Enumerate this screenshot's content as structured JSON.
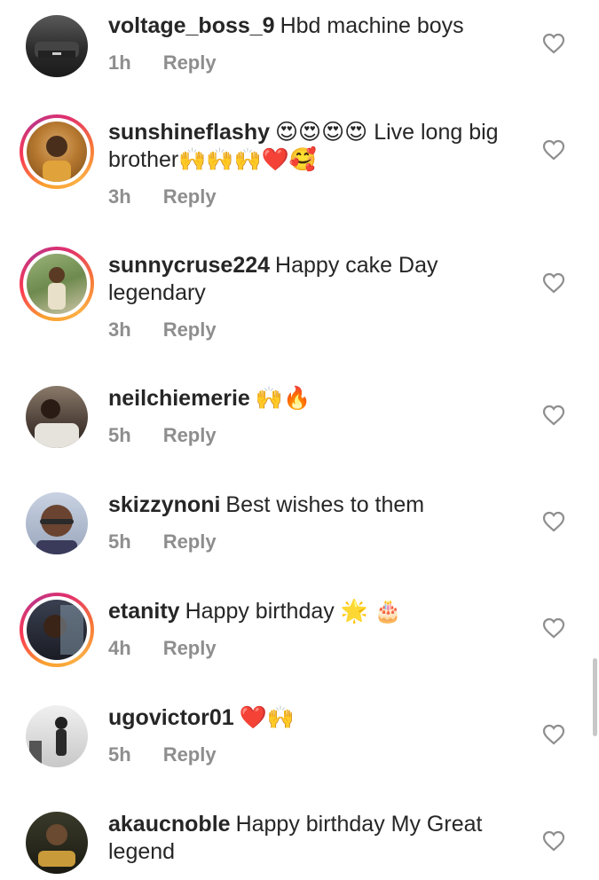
{
  "comments": [
    {
      "username": "voltage_boss_9",
      "text": "Hbd machine boys",
      "time": "1h",
      "reply": "Reply",
      "avatar_bg": "#3a3a3a",
      "story": false
    },
    {
      "username": "sunshineflashy",
      "text": "😍😍😍😍 Live long big brother🙌🙌🙌❤️🥰",
      "time": "3h",
      "reply": "Reply",
      "avatar_bg": "#c98a3a",
      "story": true
    },
    {
      "username": "sunnycruse224",
      "text": "Happy cake Day legendary",
      "time": "3h",
      "reply": "Reply",
      "avatar_bg": "#8fa56b",
      "story": true
    },
    {
      "username": "neilchiemerie",
      "text": "🙌🔥",
      "time": "5h",
      "reply": "Reply",
      "avatar_bg": "#6b5a4e",
      "story": false
    },
    {
      "username": "skizzynoni",
      "text": "Best wishes to them",
      "time": "5h",
      "reply": "Reply",
      "avatar_bg": "#a0a8b8",
      "story": false
    },
    {
      "username": "etanity",
      "text": "Happy birthday 🌟 🎂",
      "time": "4h",
      "reply": "Reply",
      "avatar_bg": "#2c3142",
      "story": true
    },
    {
      "username": "ugovictor01",
      "text": "❤️🙌",
      "time": "5h",
      "reply": "Reply",
      "avatar_bg": "#d7d7d7",
      "story": false
    },
    {
      "username": "akaucnoble",
      "text": "Happy birthday My Great legend",
      "time": "",
      "reply": "",
      "avatar_bg": "#2a2a22",
      "story": false
    }
  ],
  "icons": {
    "like": "heart-outline-icon"
  },
  "colors": {
    "text": "#262626",
    "meta": "#8e8e8e",
    "heart": "#8e8e8e"
  }
}
